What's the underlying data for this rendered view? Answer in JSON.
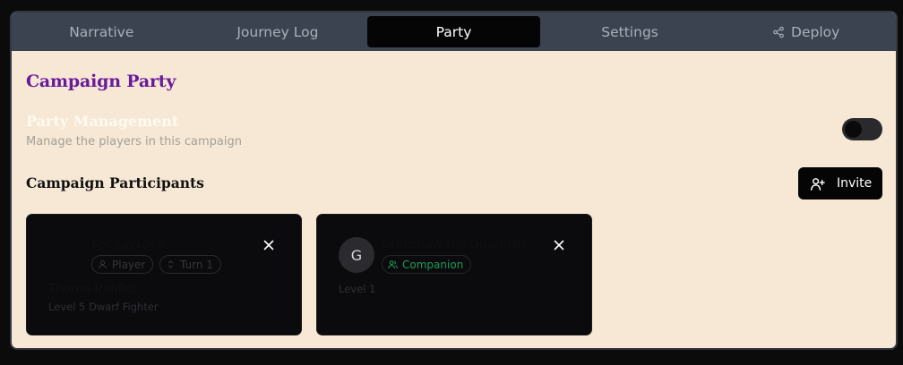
{
  "tabs": [
    {
      "label": "Narrative",
      "active": false
    },
    {
      "label": "Journey Log",
      "active": false
    },
    {
      "label": "Party",
      "active": true
    },
    {
      "label": "Settings",
      "active": false
    },
    {
      "label": "Deploy",
      "active": false,
      "icon": "share-icon"
    }
  ],
  "page": {
    "title": "Campaign Party",
    "management_title": "Party Management",
    "management_desc": "Manage the players in this campaign",
    "management_toggle_on": false,
    "participants_title": "Campaign Participants",
    "invite_label": "Invite"
  },
  "participants": [
    {
      "name": "KoeppyLoco",
      "badges": [
        "Player",
        "Turn 1"
      ],
      "character": "Thorne Ironfist",
      "character_desc": "Level 5 Dwarf Fighter"
    },
    {
      "avatar_letter": "G",
      "name": "Grimshaw the Guardian",
      "badges": [
        "Companion"
      ],
      "level": "Level 1"
    }
  ],
  "colors": {
    "tabbar": "#3b4350",
    "active_tab": "#050505",
    "page_bg": "#f6e8d4",
    "title_purple": "#6a1b9a",
    "companion_green": "#1f9a5a"
  }
}
